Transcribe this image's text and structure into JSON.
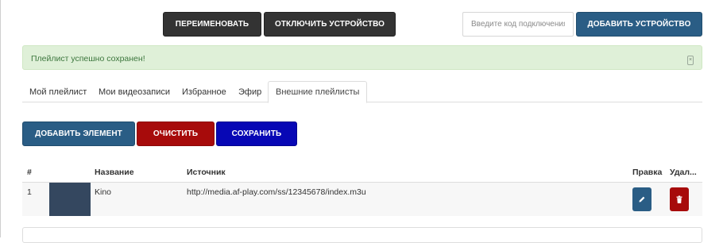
{
  "toolbar": {
    "rename_label": "Переименовать",
    "disconnect_label": "Отключить устройство",
    "code_placeholder": "Введите код подключения",
    "add_device_label": "Добавить устройство"
  },
  "alert": {
    "message": "Плейлист успешно сохранен!",
    "close_glyph": "×"
  },
  "tabs": [
    {
      "label": "Мой плейлист"
    },
    {
      "label": "Мои видеозаписи"
    },
    {
      "label": "Избранное"
    },
    {
      "label": "Эфир"
    },
    {
      "label": "Внешние плейлисты",
      "active": true
    }
  ],
  "actions": {
    "add_element_label": "Добавить элемент",
    "clear_label": "Очистить",
    "save_label": "Сохранить"
  },
  "table": {
    "headers": {
      "num": "#",
      "name": "Название",
      "source": "Источник",
      "edit": "Правка",
      "delete": "Удал..."
    },
    "rows": [
      {
        "num": "1",
        "name": "Kino",
        "source": "http://media.af-play.com/ss/12345678/index.m3u"
      }
    ]
  },
  "colors": {
    "primary": "#2a5d85",
    "danger": "#a70b0b",
    "save": "#0707b5",
    "dark": "#333333",
    "success_bg": "#dff0d8",
    "success_text": "#3c763d"
  },
  "icons": {
    "edit": "pencil-icon",
    "delete": "trash-icon",
    "close": "close-icon"
  }
}
